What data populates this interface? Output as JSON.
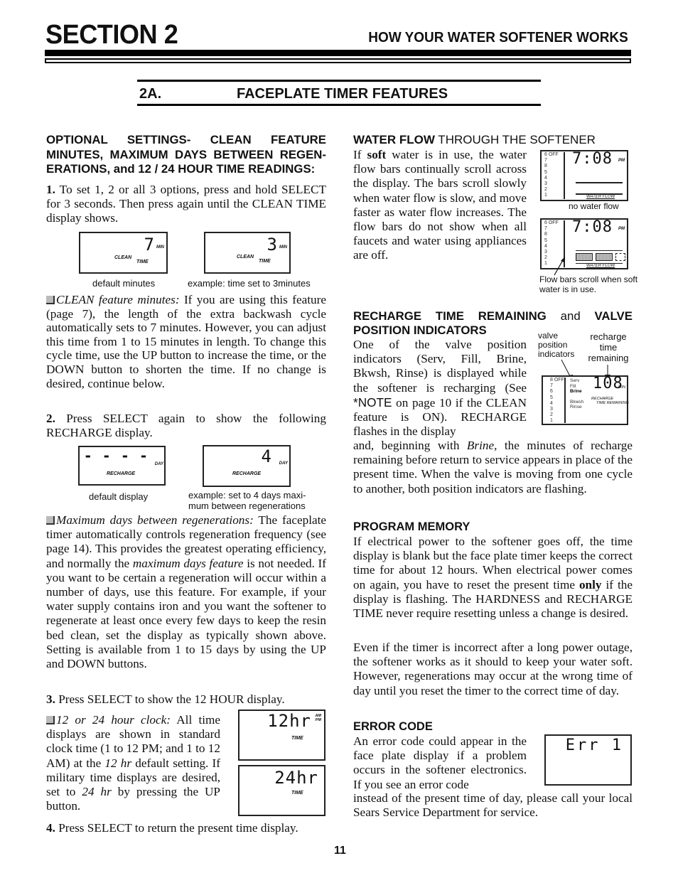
{
  "header": {
    "section_title": "SECTION 2",
    "section_subtitle": "HOW YOUR WATER SOFTENER WORKS"
  },
  "subsection": {
    "number": "2A.",
    "title": "FACEPLATE TIMER FEATURES"
  },
  "left": {
    "optional_heading": "OPTIONAL SETTINGS- CLEAN FEATURE MINUTES, MAXIMUM DAYS BETWEEN REGEN-ERATIONS, and 12 / 24 HOUR TIME READINGS:",
    "step1_num": "1.",
    "step1_text": " To set 1, 2 or all 3 options, press and hold SELECT for 3 seconds. Then press again until the CLEAN TIME display shows.",
    "clean_displays": [
      {
        "digit": "7",
        "unit": "MIN",
        "label1": "CLEAN",
        "label2": "TIME",
        "caption": "default minutes"
      },
      {
        "digit": "3",
        "unit": "MIN",
        "label1": "CLEAN",
        "label2": "TIME",
        "caption": "example: time set to 3minutes"
      }
    ],
    "clean_title": "CLEAN feature minutes:",
    "clean_text": " If you are using this feature (page 7), the length of the extra backwash cycle automatically sets to 7 minutes. However, you can adjust this time from 1 to 15 minutes in length. To change this cycle time, use the UP button to increase the time, or the DOWN button to shorten the time. If no change is desired, continue below.",
    "step2_num": "2.",
    "step2_text": " Press SELECT again to show the following RECHARGE display.",
    "recharge_displays": [
      {
        "digit": "- - - -",
        "unit": "DAY",
        "label": "RECHARGE",
        "caption": "default display"
      },
      {
        "digit": "4",
        "unit": "DAY",
        "label": "RECHARGE",
        "caption": "example: set to 4 days maxi-mum between regenerations"
      }
    ],
    "maxdays_title": "Maximum days between regenerations:",
    "maxdays_text_a": " The faceplate timer automatically controls regeneration frequency (see page 14). This provides the greatest operating efficiency, and normally the ",
    "maxdays_text_italic": "maximum days feature",
    "maxdays_text_b": " is not needed. If you want to be certain a regeneration will occur within a number of days, use this feature. For example, if your water supply contains iron and you want the softener to regenerate at least once every few days to keep the resin bed clean, set the display as typically shown above. Setting is available from 1 to 15 days by using the UP and DOWN buttons.",
    "step3_num": "3.",
    "step3_text": " Press SELECT to show the 12 HOUR display.",
    "clock_title": "12 or 24 hour clock:",
    "clock_text_a": " All time displays are shown in standard clock time (1 to 12 PM; and 1 to 12 AM) at the ",
    "clock_text_italic1": "12 hr",
    "clock_text_b": " default setting. If military time displays are desired, set to ",
    "clock_text_italic2": "24 hr",
    "clock_text_c": " by pressing the UP button.",
    "clock_displays": [
      {
        "digit": "12hr",
        "ampm_top": "AM",
        "ampm_bottom": "PM",
        "label": "TIME"
      },
      {
        "digit": "24hr",
        "label": "TIME"
      }
    ],
    "step4_num": "4.",
    "step4_text": " Press SELECT to return the present time display."
  },
  "right": {
    "waterflow_heading_bold": "WATER FLOW",
    "waterflow_heading_rest": " THROUGH THE SOFTENER",
    "waterflow_text_a": "If ",
    "waterflow_text_bold": "soft",
    "waterflow_text_b": " water is in use, the water flow bars continually scroll across the display. The bars scroll slowly when water flow is slow, and move faster as water flow increases. The flow bars do not show when all faucets and water using appliances are off.",
    "flow_displays": [
      {
        "time": "7:08",
        "ampm": "PM",
        "scale": [
          "6 OFF",
          "7",
          "8",
          "5",
          "4",
          "3",
          "2",
          "1"
        ],
        "label": "WATER FLOW",
        "caption": "no water flow"
      },
      {
        "time": "7:08",
        "ampm": "PM",
        "scale": [
          "6 OFF",
          "7",
          "8",
          "5",
          "4",
          "3",
          "2",
          "1"
        ],
        "label": "WATER FLOW",
        "caption": "Flow bars scroll when soft water is in use."
      }
    ],
    "recharge_heading_bold1": "RECHARGE TIME REMAINING",
    "recharge_heading_and": " and ",
    "recharge_heading_bold2": "VALVE POSITION INDICATORS",
    "recharge_text_a": "One of the valve position indicators (Serv, Fill, Brine, Bkwsh, Rinse) is displayed while the softener is recharging (See ",
    "recharge_text_note": "*NOTE",
    "recharge_text_b": " on page 10 if the CLEAN feature is ON). RECHARGE flashes in the display",
    "recharge_text_c": "and, beginning with ",
    "recharge_text_italic": "Brine,",
    "recharge_text_d": " the minutes of recharge remaining before return to service appears in place of the present time. When the valve is moving from one cycle to another, both position indicators are flashing.",
    "valve_diagram": {
      "label_left": "valve position indicators",
      "label_right": "recharge time remaining",
      "scale": [
        "8 OFF",
        "7",
        "6",
        "5",
        "4",
        "3",
        "2",
        "1"
      ],
      "positions": [
        "Serv",
        "Fill",
        "Brine",
        "",
        "Bkwsh",
        "Rinse"
      ],
      "digits": "108",
      "unit": "MIN",
      "label1": "RECHARGE",
      "label2": "TIME REMAINING"
    },
    "memory_heading": "PROGRAM MEMORY",
    "memory_text_a": "If electrical power to the softener goes off, the time display is blank but the face plate timer keeps the correct time for about 12 hours. When electrical power comes on again, you have to reset the present time ",
    "memory_text_bold": "only",
    "memory_text_b": " if the display is flashing. The HARDNESS and RECHARGE TIME never require resetting unless a change is desired.",
    "memory_text2": "Even if the timer is incorrect after a long power outage, the softener works as it should to keep your water soft. However, regenerations may occur at the wrong time of day until you reset the timer to the correct time of day.",
    "error_heading": "ERROR CODE",
    "error_text_a": "An error code could appear in the face plate display if a problem occurs in the softener electronics. If you see an error code",
    "error_text_b": "instead of the present time of day, please call your local Sears Service Department for service.",
    "error_display": "Err 1"
  },
  "footer": {
    "page_number": "11"
  }
}
